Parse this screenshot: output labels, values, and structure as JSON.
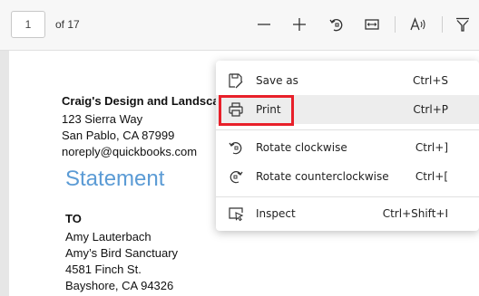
{
  "toolbar": {
    "page_number": "1",
    "page_count_label": "of 17",
    "icons": [
      "zoom-out-icon",
      "zoom-in-icon",
      "rotate-icon",
      "fit-page-icon",
      "read-aloud-icon",
      "filter-icon"
    ]
  },
  "document": {
    "company": "Craig's Design and Landscap",
    "address1": "123 Sierra Way",
    "address2": "San Pablo, CA  87999",
    "email": "noreply@quickbooks.com",
    "title": "Statement",
    "to_label": "TO",
    "to_name": "Amy Lauterbach",
    "to_company": "Amy’s Bird Sanctuary",
    "to_street": "4581 Finch St.",
    "to_city": "Bayshore, CA  94326"
  },
  "context_menu": {
    "items": [
      {
        "label": "Save as",
        "shortcut": "Ctrl+S",
        "icon": "save-as-icon"
      },
      {
        "label": "Print",
        "shortcut": "Ctrl+P",
        "icon": "printer-icon"
      },
      {
        "label": "Rotate clockwise",
        "shortcut": "Ctrl+]",
        "icon": "rotate-clockwise-icon"
      },
      {
        "label": "Rotate counterclockwise",
        "shortcut": "Ctrl+[",
        "icon": "rotate-counterclockwise-icon"
      },
      {
        "label": "Inspect",
        "shortcut": "Ctrl+Shift+I",
        "icon": "inspect-icon"
      }
    ]
  },
  "colors": {
    "highlight": "#e8202a",
    "statement_title": "#5b9bd5",
    "hover_item": "#ededed"
  }
}
